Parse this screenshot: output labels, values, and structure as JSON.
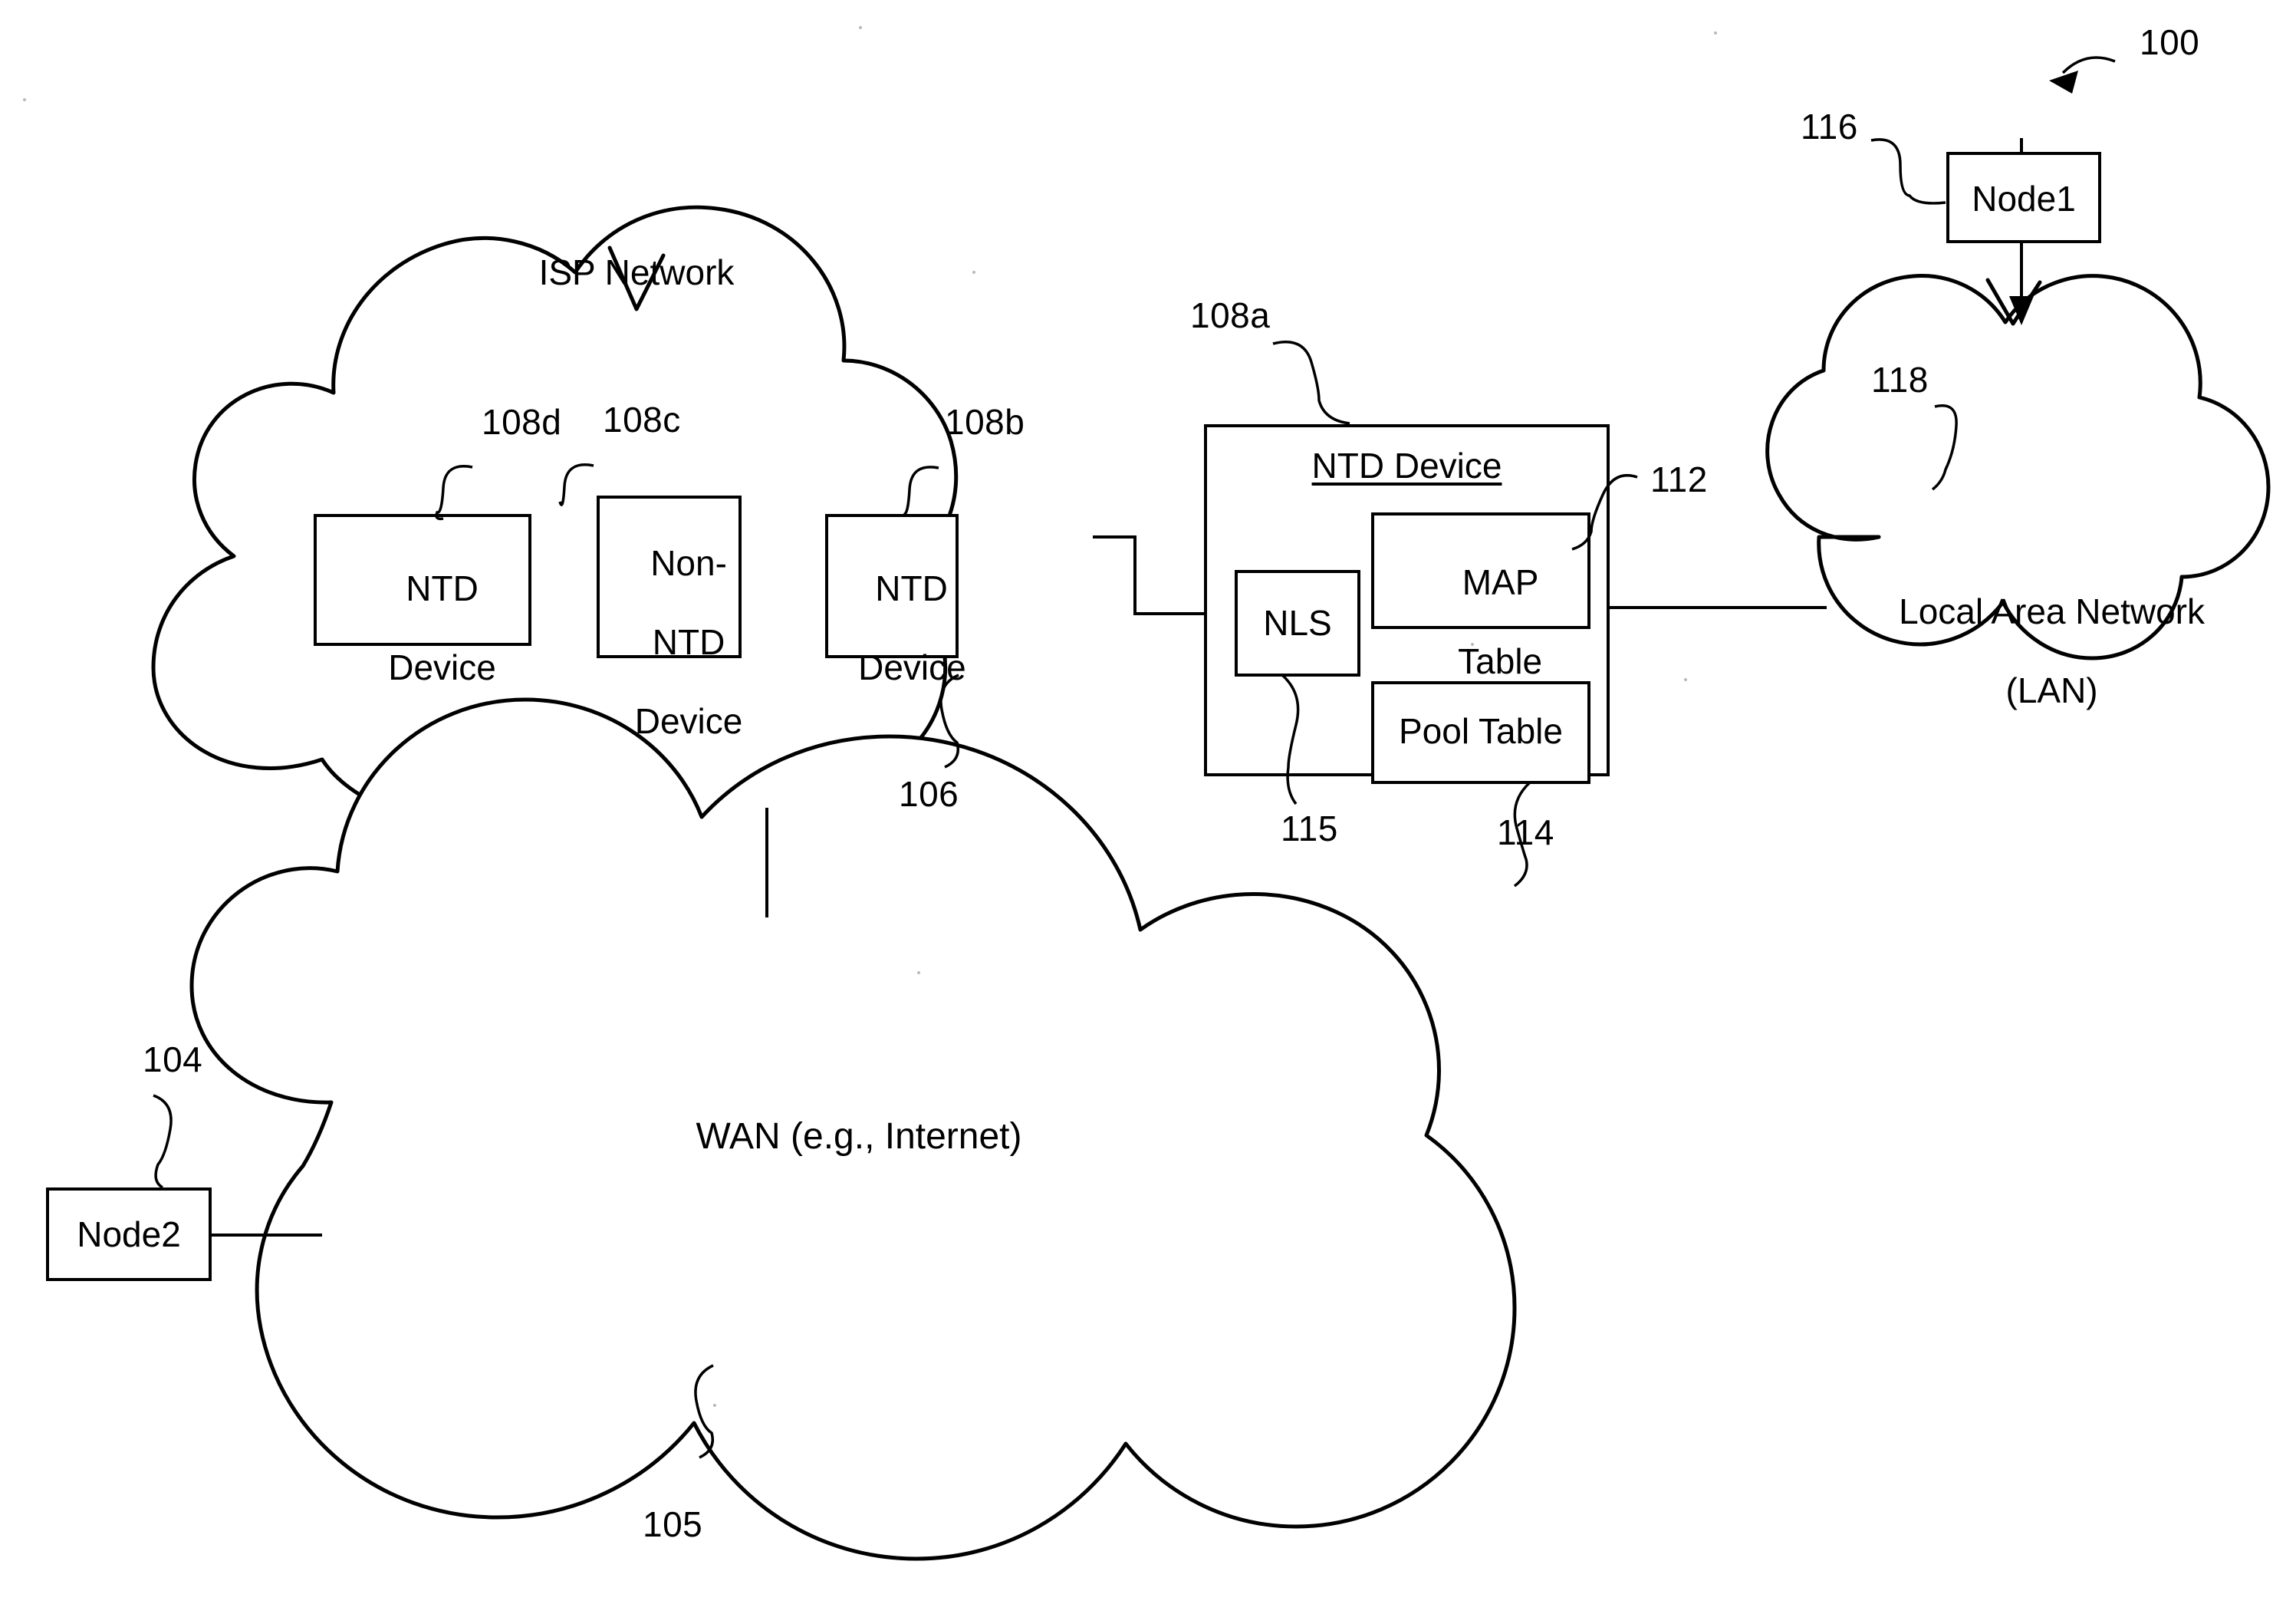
{
  "figure": {
    "number": "100",
    "domain_note": "network architecture patent diagram"
  },
  "clouds": {
    "isp": {
      "label": "ISP Network",
      "ref": "106"
    },
    "wan": {
      "label": "WAN (e.g., Internet)",
      "ref": "105"
    },
    "lan": {
      "label_line1": "Local Area Network",
      "label_line2": "(LAN)",
      "ref": "118"
    }
  },
  "isp_devices": [
    {
      "label_line1": "NTD",
      "label_line2": "Device",
      "label_line3": "",
      "ref": "108d"
    },
    {
      "label_line1": "Non-",
      "label_line2": "NTD",
      "label_line3": "Device",
      "ref": "108c"
    },
    {
      "label_line1": "NTD",
      "label_line2": "Device",
      "label_line3": "",
      "ref": "108b"
    }
  ],
  "ntd_device": {
    "title": "NTD Device",
    "ref": "108a",
    "components": [
      {
        "label_line1": "NLS",
        "label_line2": "",
        "ref": "115"
      },
      {
        "label_line1": "MAP",
        "label_line2": "Table",
        "ref": "112"
      },
      {
        "label_line1": "Pool Table",
        "label_line2": "",
        "ref": "114"
      }
    ]
  },
  "nodes": [
    {
      "label": "Node1",
      "ref": "116"
    },
    {
      "label": "Node2",
      "ref": "104"
    }
  ],
  "colors": {
    "ink": "#000000",
    "background": "#ffffff"
  }
}
